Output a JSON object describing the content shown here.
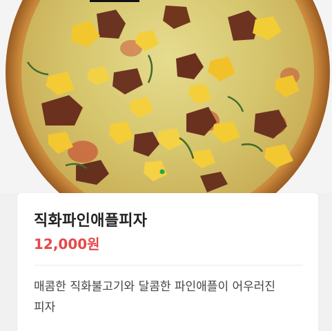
{
  "product": {
    "image_alt": "직화파인애플피자",
    "name": "직화파인애플피자",
    "price": "12,000원",
    "description": "매콤한 직화불고기와 달콤한 파인애플이 어우러진 피자"
  },
  "colors": {
    "price": "#e64848",
    "title": "#222222",
    "description": "#444444",
    "background": "#f1f1f1",
    "card": "#ffffff"
  }
}
